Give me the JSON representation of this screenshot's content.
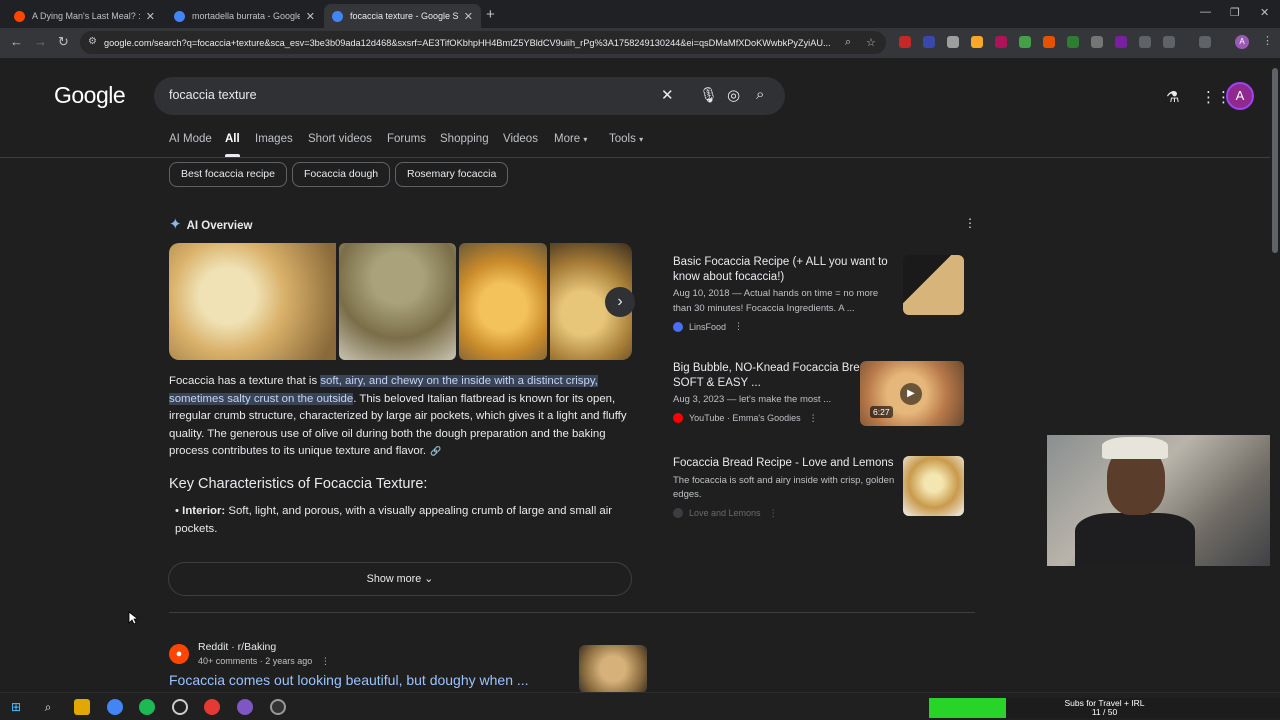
{
  "browser": {
    "tabs": [
      {
        "title": "A Dying Man's Last Meal? : r/K",
        "favicon_color": "#ff4500",
        "active": false
      },
      {
        "title": "mortadella burrata - Google Se",
        "favicon_color": "#4285f4",
        "active": false
      },
      {
        "title": "focaccia texture - Google Searc",
        "favicon_color": "#4285f4",
        "active": true
      }
    ],
    "url": "google.com/search?q=focaccia+texture&sca_esv=3be3b09ada12d468&sxsrf=AE3TifOKbhpHH4BmtZ5YBldCV9uiih_rPg%3A1758249130244&ei=qsDMaMfXDoKWwbkPyZyiAU...",
    "profile_letter": "A"
  },
  "google": {
    "logo": "Google",
    "query": "focaccia texture",
    "tabs": [
      "AI Mode",
      "All",
      "Images",
      "Short videos",
      "Forums",
      "Shopping",
      "Videos",
      "More",
      "Tools"
    ],
    "chips": [
      "Best focaccia recipe",
      "Focaccia dough",
      "Rosemary focaccia"
    ],
    "avatar_letter": "A"
  },
  "ai_overview": {
    "label": "AI Overview",
    "text_before": "Focaccia has a texture that is ",
    "text_highlight": "soft, airy, and chewy on the inside with a distinct crispy, sometimes salty crust on the outside",
    "text_after": ". This beloved Italian flatbread is known for its open, irregular crumb structure, characterized by large air pockets, which gives it a light and fluffy quality. The generous use of olive oil during both the dough preparation and the baking process contributes to its unique texture and flavor.",
    "key_heading": "Key Characteristics of Focaccia Texture:",
    "bullet_label": "Interior:",
    "bullet_text": " Soft, light, and porous, with a visually appealing crumb of large and small air pockets.",
    "show_more": "Show more"
  },
  "sources": [
    {
      "title": "Basic Focaccia Recipe (+ ALL you want to know about focaccia!)",
      "desc": "Aug 10, 2018 — Actual hands on time = no more than 30 minutes! Focaccia Ingredients. A ...",
      "site": "LinsFood",
      "site_color": "#4c6ef5"
    },
    {
      "title": "Big Bubble, NO-Knead Focaccia Bread | SOFT & EASY ...",
      "desc": "Aug 3, 2023 — let's make the most ...",
      "site": "YouTube · Emma's Goodies",
      "site_color": "#ff0000",
      "duration": "6:27"
    },
    {
      "title": "Focaccia Bread Recipe - Love and Lemons",
      "desc": "The focaccia is soft and airy inside with crisp, golden edges.",
      "site": "Love and Lemons",
      "site_color": "#5f6368"
    }
  ],
  "result": {
    "site": "Reddit · r/Baking",
    "meta": "40+ comments · 2 years ago",
    "title": "Focaccia comes out looking beautiful, but doughy when ..."
  },
  "overlay": {
    "label": "Subs for Travel + IRL",
    "count": "11 / 50",
    "progress": 0.22,
    "fill_color": "#28d428"
  }
}
